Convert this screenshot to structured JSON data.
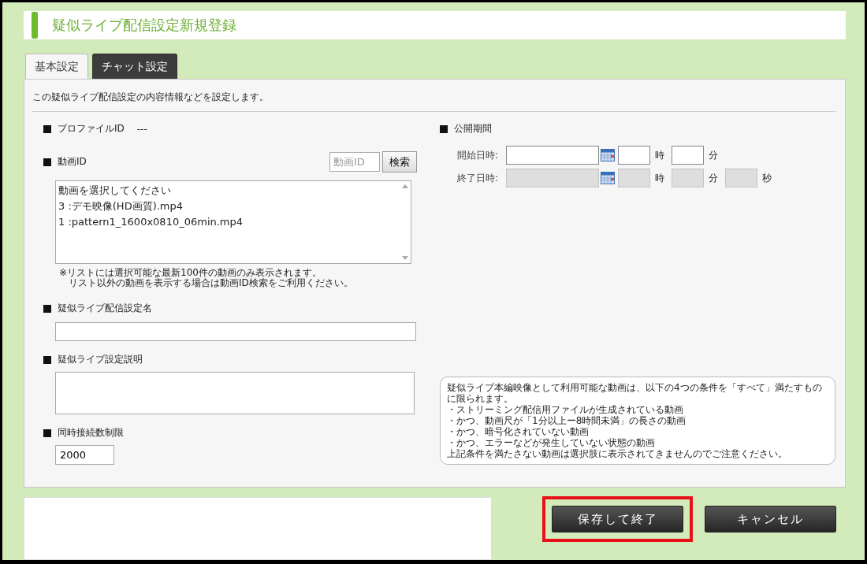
{
  "page": {
    "title": "疑似ライブ配信設定新規登録"
  },
  "tabs": [
    {
      "label": "基本設定",
      "selected": true
    },
    {
      "label": "チャット設定",
      "selected": false
    }
  ],
  "description": "この疑似ライブ配信設定の内容情報などを設定します。",
  "profile": {
    "label": "プロファイルID",
    "value": "---"
  },
  "video": {
    "label": "動画ID",
    "search": {
      "placeholder": "動画ID",
      "button": "検索"
    },
    "options": [
      {
        "label": "動画を選択してください",
        "selected": false
      },
      {
        "label": "3 :デモ映像(HD画質).mp4",
        "selected": false
      },
      {
        "label": "1 :pattern1_1600x0810_06min.mp4",
        "selected": false
      }
    ],
    "note": [
      "※リストには選択可能な最新100件の動画のみ表示されます。",
      "リスト以外の動画を表示する場合は動画ID検索をご利用ください。"
    ]
  },
  "name_field": {
    "label": "疑似ライブ配信設定名"
  },
  "description_field": {
    "label": "疑似ライブ設定説明"
  },
  "limit": {
    "label": "同時接続数制限",
    "value": "2000"
  },
  "period": {
    "label": "公開期間",
    "rows": [
      {
        "label": "開始日時:",
        "disabled": false,
        "units": [
          "時",
          "分"
        ]
      },
      {
        "label": "終了日時:",
        "disabled": true,
        "units": [
          "時",
          "分",
          "秒"
        ]
      }
    ]
  },
  "notice": [
    "疑似ライブ本編映像として利用可能な動画は、以下の4つの条件を「すべて」満たすものに限られます。",
    "・ストリーミング配信用ファイルが生成されている動画",
    "・かつ、動画尺が「1分以上ー8時間未満」の長さの動画",
    "・かつ、暗号化されていない動画",
    "・かつ、エラーなどが発生していない状態の動画",
    "上記条件を満たさない動画は選択肢に表示されてきませんのでご注意ください。"
  ],
  "buttons": [
    {
      "label": "保存して終了",
      "highlighted": true
    },
    {
      "label": "キャンセル",
      "highlighted": false
    }
  ]
}
